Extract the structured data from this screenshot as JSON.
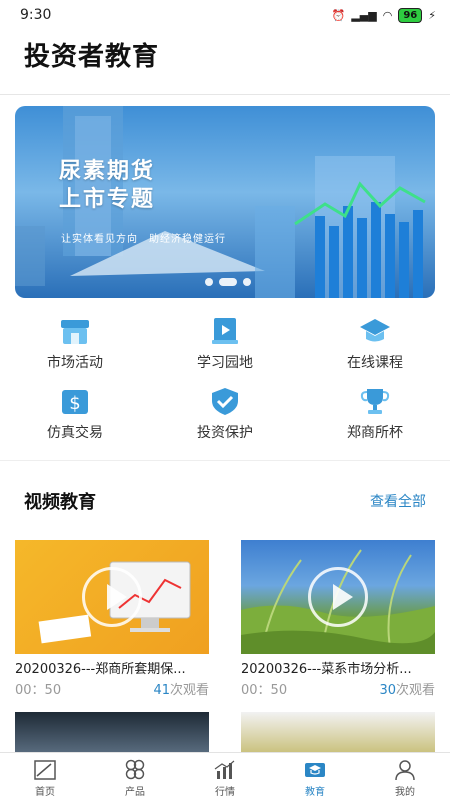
{
  "status": {
    "time": "9:30",
    "network": "4G",
    "battery": "96"
  },
  "header": {
    "title": "投资者教育"
  },
  "banner": {
    "title_line1": "尿素期货",
    "title_line2": "上市专题",
    "subtitle": "让实体看见方向　助经济稳健运行",
    "slides": 3,
    "active_slide": 1
  },
  "grid": [
    {
      "label": "市场活动",
      "icon": "storefront-icon"
    },
    {
      "label": "学习园地",
      "icon": "video-book-icon"
    },
    {
      "label": "在线课程",
      "icon": "graduation-cap-icon"
    },
    {
      "label": "仿真交易",
      "icon": "wallet-dollar-icon"
    },
    {
      "label": "投资保护",
      "icon": "shield-check-icon"
    },
    {
      "label": "郑商所杯",
      "icon": "trophy-icon"
    }
  ],
  "video_section": {
    "title": "视频教育",
    "link": "查看全部"
  },
  "videos": [
    {
      "title": "20200326---郑商所套期保...",
      "duration": "00：50",
      "views": "41",
      "views_suffix": "次观看"
    },
    {
      "title": "20200326---菜系市场分析...",
      "duration": "00：50",
      "views": "30",
      "views_suffix": "次观看"
    }
  ],
  "tabs": [
    {
      "label": "首页",
      "icon": "home-chart-icon"
    },
    {
      "label": "产品",
      "icon": "clover-icon"
    },
    {
      "label": "行情",
      "icon": "market-bars-icon"
    },
    {
      "label": "教育",
      "icon": "education-cap-icon",
      "active": true
    },
    {
      "label": "我的",
      "icon": "person-icon"
    }
  ],
  "colors": {
    "accent": "#2b86c5",
    "icon_blue": "#3a9ad9"
  }
}
